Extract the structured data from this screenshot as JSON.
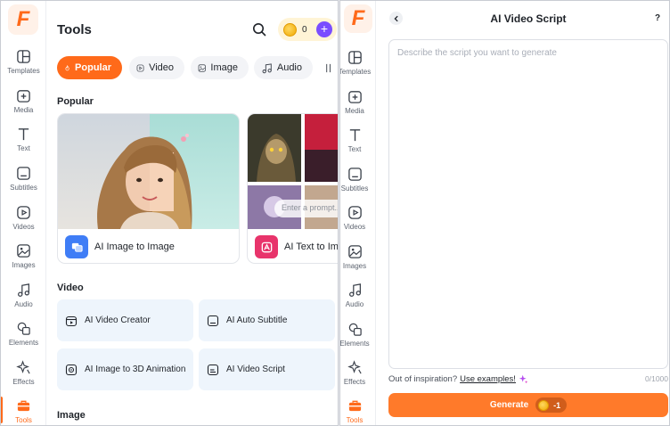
{
  "sidebar": {
    "logo_letter": "F",
    "items": [
      {
        "key": "templates",
        "label": "Templates"
      },
      {
        "key": "media",
        "label": "Media"
      },
      {
        "key": "text",
        "label": "Text"
      },
      {
        "key": "subtitles",
        "label": "Subtitles"
      },
      {
        "key": "videos",
        "label": "Videos"
      },
      {
        "key": "images",
        "label": "Images"
      },
      {
        "key": "audio",
        "label": "Audio"
      },
      {
        "key": "elements",
        "label": "Elements"
      },
      {
        "key": "effects",
        "label": "Effects"
      },
      {
        "key": "tools",
        "label": "Tools",
        "active": true
      }
    ]
  },
  "tools_panel": {
    "title": "Tools",
    "credits": "0",
    "add_credits_symbol": "+",
    "tabs": [
      {
        "label": "Popular",
        "icon": "fire-icon",
        "active": true
      },
      {
        "label": "Video",
        "icon": "play-icon"
      },
      {
        "label": "Image",
        "icon": "image-icon"
      },
      {
        "label": "Audio",
        "icon": "music-icon"
      }
    ],
    "sections": {
      "popular": "Popular",
      "video": "Video",
      "image": "Image"
    },
    "popular_cards": [
      {
        "label": "AI Image to Image",
        "icon": "image-swap-icon"
      },
      {
        "label": "AI Text to Image",
        "icon": "text-image-icon",
        "prompt_placeholder": "Enter a prompt..."
      }
    ],
    "video_tools": [
      {
        "label": "AI Video Creator",
        "icon": "video-creator-icon"
      },
      {
        "label": "AI Auto Subtitle",
        "icon": "subtitle-icon"
      },
      {
        "label": "AI Image to 3D Animation",
        "icon": "3d-animation-icon"
      },
      {
        "label": "AI Video Script",
        "icon": "script-icon"
      }
    ]
  },
  "script_panel": {
    "title": "AI Video Script",
    "help_symbol": "?",
    "placeholder": "Describe the script you want to generate",
    "inspiration_text": "Out of inspiration?",
    "examples_link": "Use examples!",
    "char_count": "0/1000",
    "generate_label": "Generate",
    "generate_cost": "-1"
  },
  "colors": {
    "accent": "#ff6a1a",
    "tile_bg": "#eef5fc",
    "credits_plus": "#7a4dff"
  }
}
